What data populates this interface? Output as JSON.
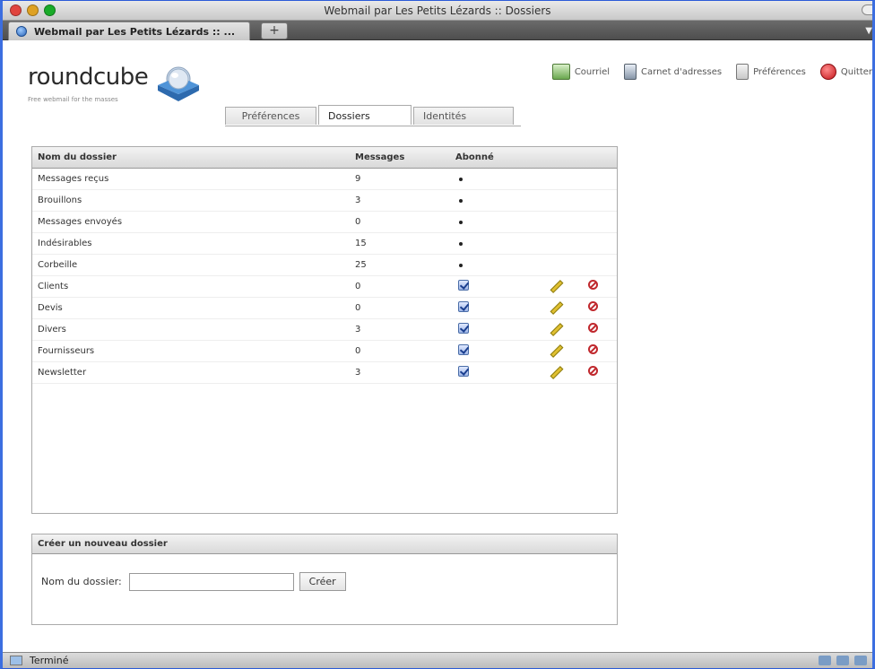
{
  "window": {
    "title": "Webmail par Les Petits Lézards :: Dossiers",
    "tab_label": "Webmail par Les Petits Lézards :: ...",
    "new_tab": "+"
  },
  "logo": {
    "name": "roundcube",
    "tagline": "Free webmail for the masses"
  },
  "topnav": {
    "items": [
      {
        "label": "Courriel",
        "icon": "mail-icon"
      },
      {
        "label": "Carnet d'adresses",
        "icon": "addressbook-icon"
      },
      {
        "label": "Préférences",
        "icon": "preferences-icon"
      },
      {
        "label": "Quitter",
        "icon": "logout-icon"
      }
    ]
  },
  "tabs": [
    {
      "label": "Préférences",
      "active": false
    },
    {
      "label": "Dossiers",
      "active": true
    },
    {
      "label": "Identités",
      "active": false
    }
  ],
  "folders": {
    "headers": {
      "name": "Nom du dossier",
      "messages": "Messages",
      "subscribed": "Abonné"
    },
    "rows": [
      {
        "name": "Messages reçus",
        "messages": "9",
        "subscribed": "dot",
        "editable": false
      },
      {
        "name": "Brouillons",
        "messages": "3",
        "subscribed": "dot",
        "editable": false
      },
      {
        "name": "Messages envoyés",
        "messages": "0",
        "subscribed": "dot",
        "editable": false
      },
      {
        "name": "Indésirables",
        "messages": "15",
        "subscribed": "dot",
        "editable": false
      },
      {
        "name": "Corbeille",
        "messages": "25",
        "subscribed": "dot",
        "editable": false
      },
      {
        "name": "Clients",
        "messages": "0",
        "subscribed": "checked",
        "editable": true
      },
      {
        "name": "Devis",
        "messages": "0",
        "subscribed": "checked",
        "editable": true
      },
      {
        "name": "Divers",
        "messages": "3",
        "subscribed": "checked",
        "editable": true
      },
      {
        "name": "Fournisseurs",
        "messages": "0",
        "subscribed": "checked",
        "editable": true
      },
      {
        "name": "Newsletter",
        "messages": "3",
        "subscribed": "checked",
        "editable": true
      }
    ]
  },
  "create": {
    "title": "Créer un nouveau dossier",
    "label": "Nom du dossier:",
    "value": "",
    "button": "Créer"
  },
  "status": {
    "text": "Terminé"
  }
}
